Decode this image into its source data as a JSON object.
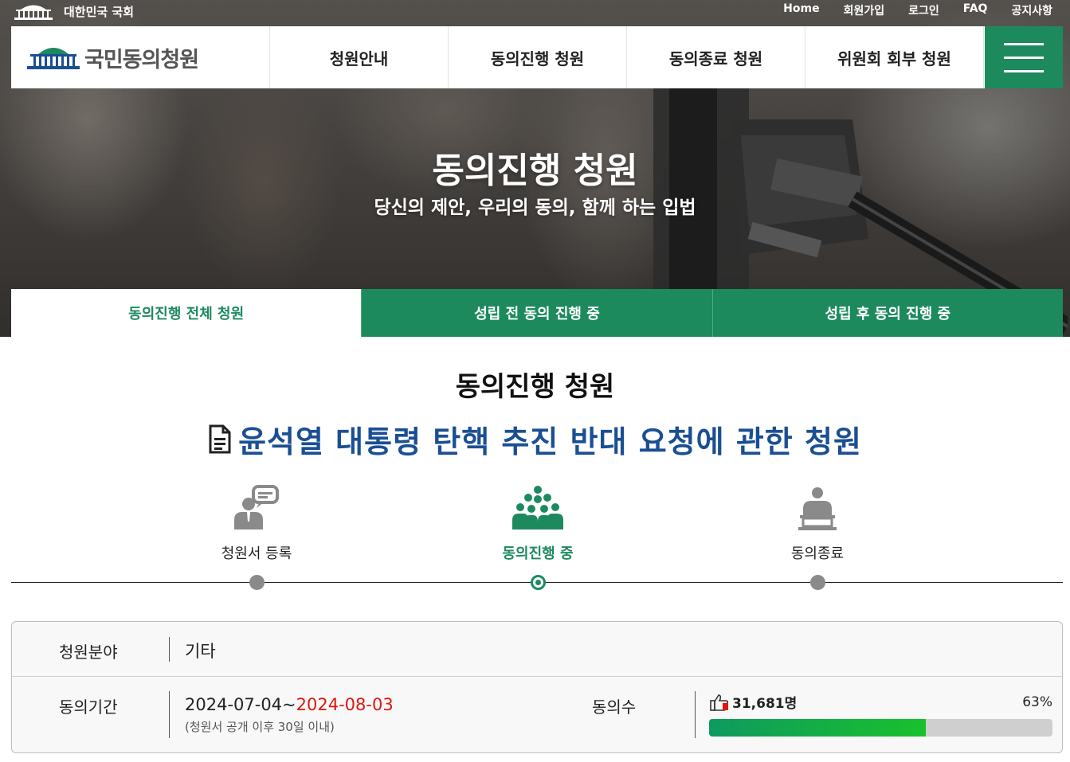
{
  "utility": {
    "assembly_name": "대한민국 국회",
    "links": [
      "Home",
      "회원가입",
      "로그인",
      "FAQ",
      "공지사항"
    ]
  },
  "nav": {
    "brand": "국민동의청원",
    "items": [
      "청원안내",
      "동의진행 청원",
      "동의종료 청원",
      "위원회 회부 청원"
    ]
  },
  "hero": {
    "title": "동의진행 청원",
    "subtitle": "당신의 제안, 우리의 동의, 함께 하는 입법"
  },
  "subtabs": [
    "동의진행 전체 청원",
    "성립 전 동의 진행 중",
    "성립 후 동의 진행 중"
  ],
  "main": {
    "section_title": "동의진행 청원",
    "petition_title": "윤석열 대통령 탄핵 추진 반대 요청에 관한 청원"
  },
  "steps": [
    {
      "label": "청원서 등록",
      "icon": "speaker-icon"
    },
    {
      "label": "동의진행 중",
      "icon": "group-icon"
    },
    {
      "label": "동의종료",
      "icon": "podium-icon"
    }
  ],
  "info": {
    "field_label": "청원분야",
    "field_value": "기타",
    "period_label": "동의기간",
    "period_start": "2024-07-04~",
    "period_end": "2024-08-03",
    "period_note": "(청원서 공개 이후 30일 이내)",
    "count_label": "동의수",
    "count_value": "31,681명",
    "percent_text": "63%",
    "progress": 0.63
  },
  "colors": {
    "brand_green": "#1d8a5e",
    "title_blue": "#1a4f93",
    "date_red": "#e0170f"
  }
}
